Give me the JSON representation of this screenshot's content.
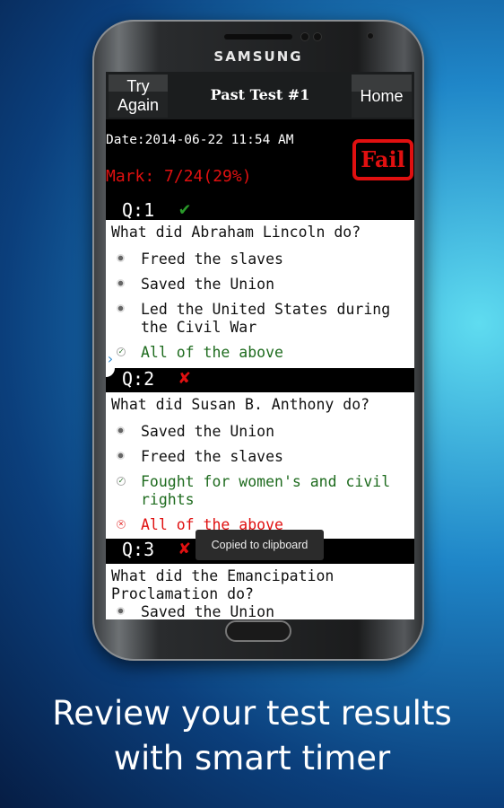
{
  "device": {
    "brand": "SAMSUNG"
  },
  "header": {
    "try_again": "Try Again",
    "title": "Past Test #1",
    "home": "Home"
  },
  "summary": {
    "date": "Date:2014-06-22 11:54 AM",
    "mark": "Mark: 7/24(29%)",
    "result_badge": "Fail"
  },
  "questions": [
    {
      "label": "Q:1",
      "status": "correct",
      "status_icon": "✔",
      "question": "What did Abraham Lincoln do?",
      "options": [
        {
          "text": "Freed the slaves",
          "state": "unselected"
        },
        {
          "text": "Saved the Union",
          "state": "unselected"
        },
        {
          "text": "Led the United States during\nthe Civil War",
          "state": "unselected"
        },
        {
          "text": "All of the above",
          "state": "correct"
        }
      ]
    },
    {
      "label": "Q:2",
      "status": "wrong",
      "status_icon": "✘",
      "question": "What did Susan B. Anthony do?",
      "options": [
        {
          "text": "Saved the Union",
          "state": "unselected"
        },
        {
          "text": "Freed the slaves",
          "state": "unselected"
        },
        {
          "text": "Fought for women's and civil\nrights",
          "state": "correct"
        },
        {
          "text": "All of the above",
          "state": "wrong"
        }
      ]
    },
    {
      "label": "Q:3",
      "status": "wrong",
      "status_icon": "✘",
      "question": "What did the Emancipation\nProclamation do?",
      "options": [
        {
          "text": "Saved the Union",
          "state": "unselected"
        }
      ]
    }
  ],
  "toast": "Copied to clipboard",
  "caption": {
    "line1": "Review your test results",
    "line2": "with smart timer"
  },
  "colors": {
    "correct": "#1e6b1e",
    "wrong": "#e01010",
    "check": "#2a9a2a"
  }
}
